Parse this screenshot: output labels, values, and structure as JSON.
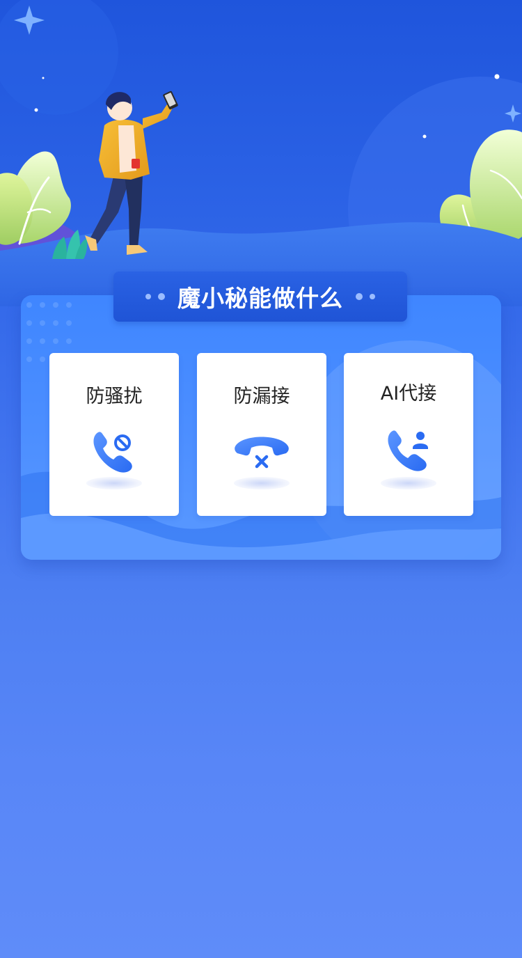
{
  "section": {
    "title": "魔小秘能做什么"
  },
  "features": [
    {
      "label": "防骚扰",
      "icon": "phone-block-icon"
    },
    {
      "label": "防漏接",
      "icon": "missed-call-icon"
    },
    {
      "label": "AI代接",
      "icon": "ai-answer-icon"
    }
  ],
  "colors": {
    "background_top": "#1f55dc",
    "background_bottom": "#5f8cf9",
    "card": "#4d8fff",
    "banner": "#2360df",
    "icon_blue": "#3b7bff"
  }
}
